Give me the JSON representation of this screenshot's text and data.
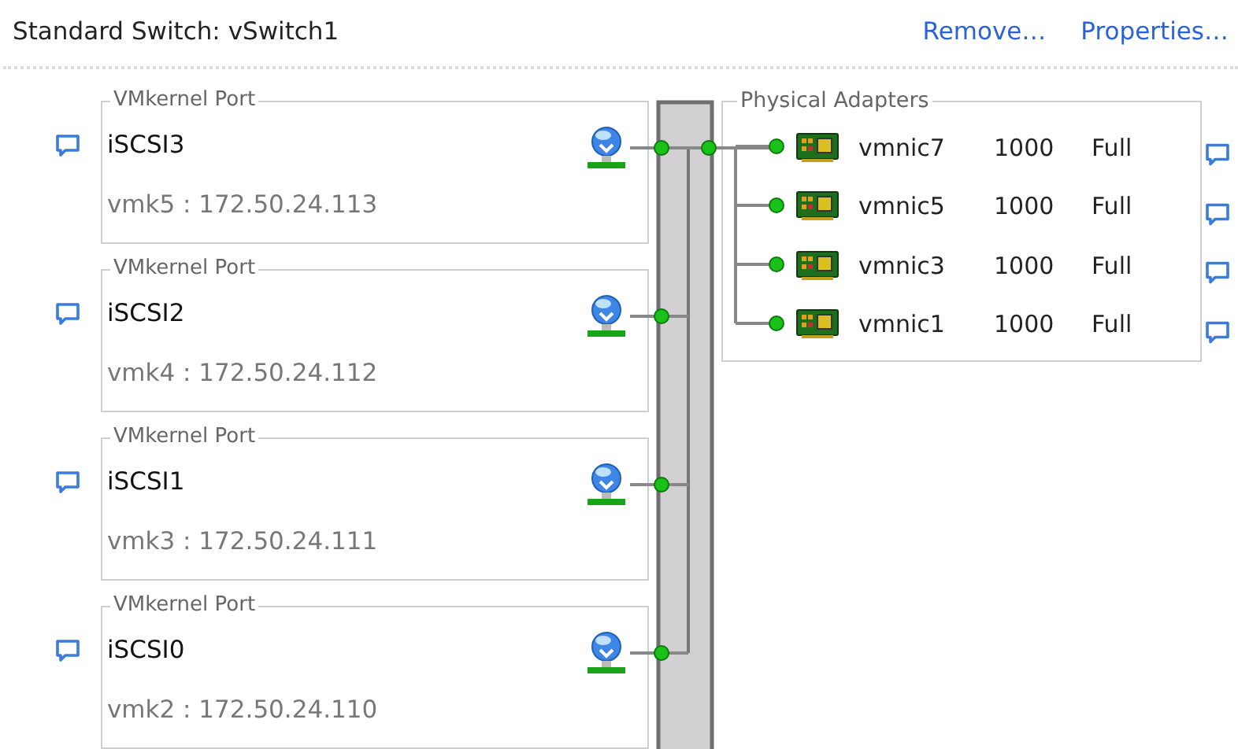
{
  "switch": {
    "title": "Standard Switch: vSwitch1",
    "actions": [
      {
        "label": "Remove…"
      },
      {
        "label": "Properties…"
      }
    ]
  },
  "port_groups": [
    {
      "type": "VMkernel Port",
      "name": "iSCSI3",
      "detail": "vmk5 : 172.50.24.113"
    },
    {
      "type": "VMkernel Port",
      "name": "iSCSI2",
      "detail": "vmk4 : 172.50.24.112"
    },
    {
      "type": "VMkernel Port",
      "name": "iSCSI1",
      "detail": "vmk3 : 172.50.24.111"
    },
    {
      "type": "VMkernel Port",
      "name": "iSCSI0",
      "detail": "vmk2 : 172.50.24.110"
    }
  ],
  "physical_adapters": {
    "title": "Physical Adapters",
    "adapters": [
      {
        "name": "vmnic7",
        "speed": "1000",
        "duplex": "Full"
      },
      {
        "name": "vmnic5",
        "speed": "1000",
        "duplex": "Full"
      },
      {
        "name": "vmnic3",
        "speed": "1000",
        "duplex": "Full"
      },
      {
        "name": "vmnic1",
        "speed": "1000",
        "duplex": "Full"
      }
    ]
  }
}
